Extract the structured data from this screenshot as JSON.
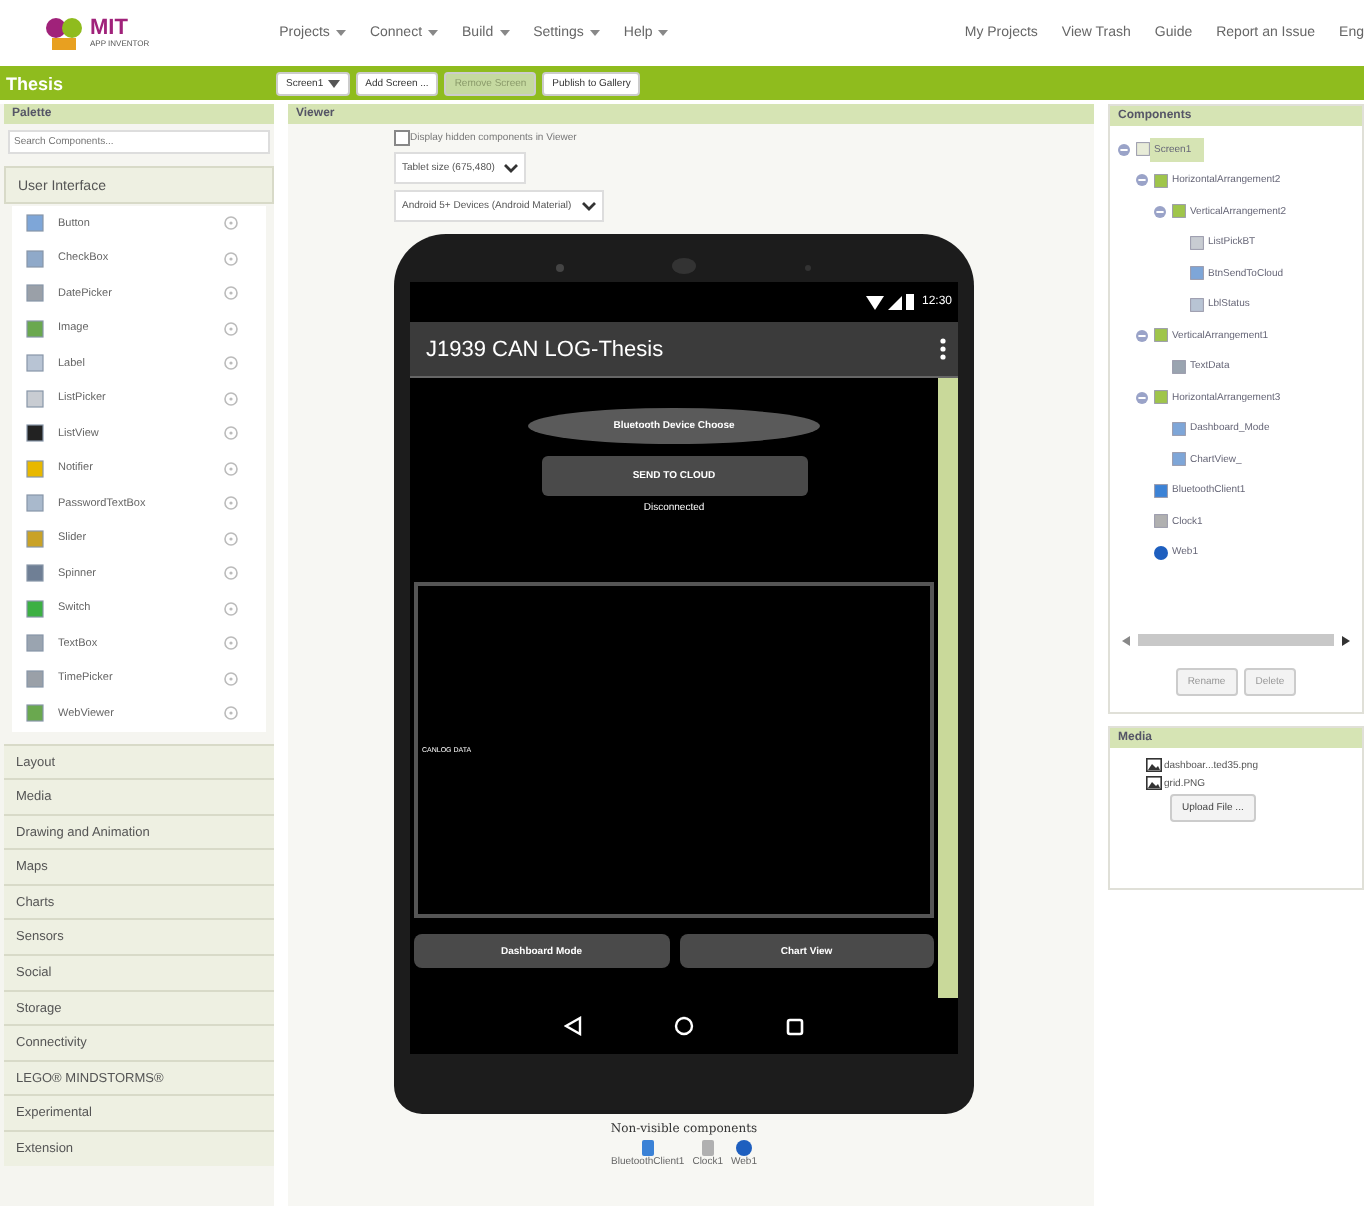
{
  "app_bar": {
    "logo": {
      "title": "MIT",
      "subtitle": "APP INVENTOR"
    },
    "menus": [
      "Projects",
      "Connect",
      "Build",
      "Settings",
      "Help"
    ],
    "links": [
      "My Projects",
      "View Trash",
      "Guide",
      "Report an Issue",
      "Eng"
    ]
  },
  "project_bar": {
    "title": "Thesis",
    "buttons": [
      {
        "label": "Screen1",
        "dropdown": true,
        "disabled": false
      },
      {
        "label": "Add Screen ...",
        "dropdown": false,
        "disabled": false
      },
      {
        "label": "Remove Screen",
        "dropdown": false,
        "disabled": true
      },
      {
        "label": "Publish to Gallery",
        "dropdown": false,
        "disabled": false
      }
    ]
  },
  "palette": {
    "title": "Palette",
    "search": {
      "placeholder": "Search Components..."
    },
    "open_category": "User Interface",
    "items": [
      {
        "label": "Button",
        "kind": "button"
      },
      {
        "label": "CheckBox",
        "kind": "checkbox"
      },
      {
        "label": "DatePicker",
        "kind": "calendar"
      },
      {
        "label": "Image",
        "kind": "image"
      },
      {
        "label": "Label",
        "kind": "label"
      },
      {
        "label": "ListPicker",
        "kind": "list"
      },
      {
        "label": "ListView",
        "kind": "listview"
      },
      {
        "label": "Notifier",
        "kind": "warning"
      },
      {
        "label": "PasswordTextBox",
        "kind": "password"
      },
      {
        "label": "Slider",
        "kind": "slider"
      },
      {
        "label": "Spinner",
        "kind": "spinner"
      },
      {
        "label": "Switch",
        "kind": "switch"
      },
      {
        "label": "TextBox",
        "kind": "textbox"
      },
      {
        "label": "TimePicker",
        "kind": "calendar"
      },
      {
        "label": "WebViewer",
        "kind": "image"
      }
    ],
    "categories": [
      "Layout",
      "Media",
      "Drawing and Animation",
      "Maps",
      "Charts",
      "Sensors",
      "Social",
      "Storage",
      "Connectivity",
      "LEGO® MINDSTORMS®",
      "Experimental",
      "Extension"
    ]
  },
  "viewer": {
    "title": "Viewer",
    "hidden_toggle": {
      "label": "Display hidden components in Viewer",
      "checked": false
    },
    "size_select": "Tablet size (675,480)",
    "theme_select": "Android 5+ Devices (Android Material)",
    "phone": {
      "clock": "12:30",
      "app_title": "J1939 CAN LOG-Thesis",
      "picker": "Bluetooth Device Choose",
      "send_button": "SEND TO CLOUD",
      "status": "Disconnected",
      "textbox": "CANLOG DATA",
      "bottom_buttons": [
        "Dashboard Mode",
        "Chart View"
      ]
    },
    "nonvisible": {
      "title": "Non-visible components",
      "items": [
        {
          "label": "BluetoothClient1",
          "kind": "bluetooth"
        },
        {
          "label": "Clock1",
          "kind": "clock"
        },
        {
          "label": "Web1",
          "kind": "web"
        }
      ]
    }
  },
  "components": {
    "title": "Components",
    "tree": [
      {
        "label": "Screen1",
        "kind": "screen",
        "selected": true,
        "expanded": true,
        "children": [
          {
            "label": "HorizontalArrangement2",
            "kind": "arrangement",
            "selected": false,
            "expanded": true,
            "children": [
              {
                "label": "VerticalArrangement2",
                "kind": "arrangement",
                "selected": false,
                "expanded": true,
                "children": [
                  {
                    "label": "ListPickBT",
                    "kind": "list",
                    "selected": false
                  },
                  {
                    "label": "BtnSendToCloud",
                    "kind": "button",
                    "selected": false
                  },
                  {
                    "label": "LblStatus",
                    "kind": "label",
                    "selected": false
                  }
                ]
              }
            ]
          },
          {
            "label": "VerticalArrangement1",
            "kind": "arrangement",
            "selected": false,
            "expanded": true,
            "children": [
              {
                "label": "TextData",
                "kind": "textbox",
                "selected": false
              }
            ]
          },
          {
            "label": "HorizontalArrangement3",
            "kind": "arrangement",
            "selected": false,
            "expanded": true,
            "children": [
              {
                "label": "Dashboard_Mode",
                "kind": "button",
                "selected": false
              },
              {
                "label": "ChartView_",
                "kind": "button",
                "selected": false
              }
            ]
          },
          {
            "label": "BluetoothClient1",
            "kind": "bluetooth",
            "selected": false
          },
          {
            "label": "Clock1",
            "kind": "clock",
            "selected": false
          },
          {
            "label": "Web1",
            "kind": "web",
            "selected": false
          }
        ]
      }
    ],
    "buttons": [
      {
        "label": "Rename",
        "disabled": true
      },
      {
        "label": "Delete",
        "disabled": true
      }
    ]
  },
  "media": {
    "title": "Media",
    "files": [
      "dashboar...ted35.png",
      "grid.PNG"
    ],
    "upload": "Upload File ..."
  }
}
